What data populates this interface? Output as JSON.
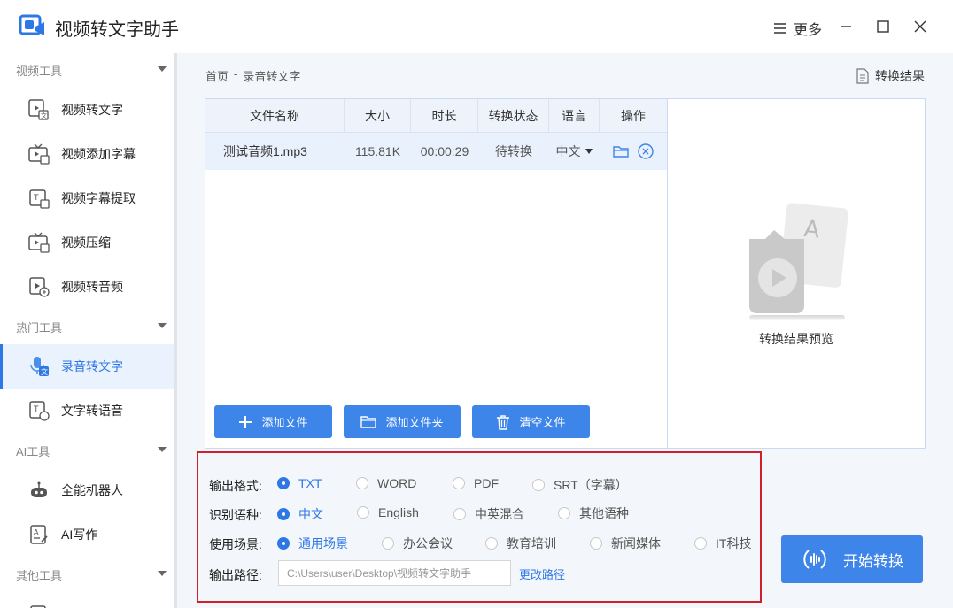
{
  "app": {
    "title": "视频转文字助手"
  },
  "window": {
    "more_label": "更多"
  },
  "sidebar": {
    "sections": [
      {
        "label": "视频工具"
      },
      {
        "label": "热门工具"
      },
      {
        "label": "AI工具"
      },
      {
        "label": "其他工具"
      }
    ],
    "items": [
      {
        "label": "视频转文字",
        "icon": "video-to-text-icon"
      },
      {
        "label": "视频添加字幕",
        "icon": "tv-subtitle-icon"
      },
      {
        "label": "视频字幕提取",
        "icon": "subtitle-extract-icon"
      },
      {
        "label": "视频压缩",
        "icon": "video-compress-icon"
      },
      {
        "label": "视频转音频",
        "icon": "video-to-audio-icon"
      },
      {
        "label": "录音转文字",
        "icon": "mic-to-text-icon",
        "active": true
      },
      {
        "label": "文字转语音",
        "icon": "text-to-speech-icon"
      },
      {
        "label": "全能机器人",
        "icon": "robot-icon"
      },
      {
        "label": "AI写作",
        "icon": "ai-writing-icon"
      }
    ]
  },
  "breadcrumb": {
    "home": "首页",
    "sep": "-",
    "current": "录音转文字"
  },
  "result_link": "转换结果",
  "table": {
    "headers": [
      "文件名称",
      "大小",
      "时长",
      "转换状态",
      "语言",
      "操作"
    ],
    "rows": [
      {
        "name": "测试音频1.mp3",
        "size": "115.81K",
        "duration": "00:00:29",
        "status": "待转换",
        "language": "中文"
      }
    ]
  },
  "preview": {
    "label": "转换结果预览"
  },
  "actions": {
    "add_file": "添加文件",
    "add_folder": "添加文件夹",
    "clear_files": "清空文件"
  },
  "settings": {
    "format": {
      "label": "输出格式:",
      "options": [
        "TXT",
        "WORD",
        "PDF",
        "SRT（字幕）"
      ],
      "selected": "TXT"
    },
    "language": {
      "label": "识别语种:",
      "options": [
        "中文",
        "English",
        "中英混合",
        "其他语种"
      ],
      "selected": "中文"
    },
    "scene": {
      "label": "使用场景:",
      "options": [
        "通用场景",
        "办公会议",
        "教育培训",
        "新闻媒体",
        "IT科技"
      ],
      "selected": "通用场景"
    },
    "path": {
      "label": "输出路径:",
      "value": "C:\\Users\\user\\Desktop\\视频转文字助手",
      "change": "更改路径"
    }
  },
  "start_button": "开始转换",
  "colors": {
    "accent": "#3e85ea",
    "highlight_border": "#d0212a"
  }
}
